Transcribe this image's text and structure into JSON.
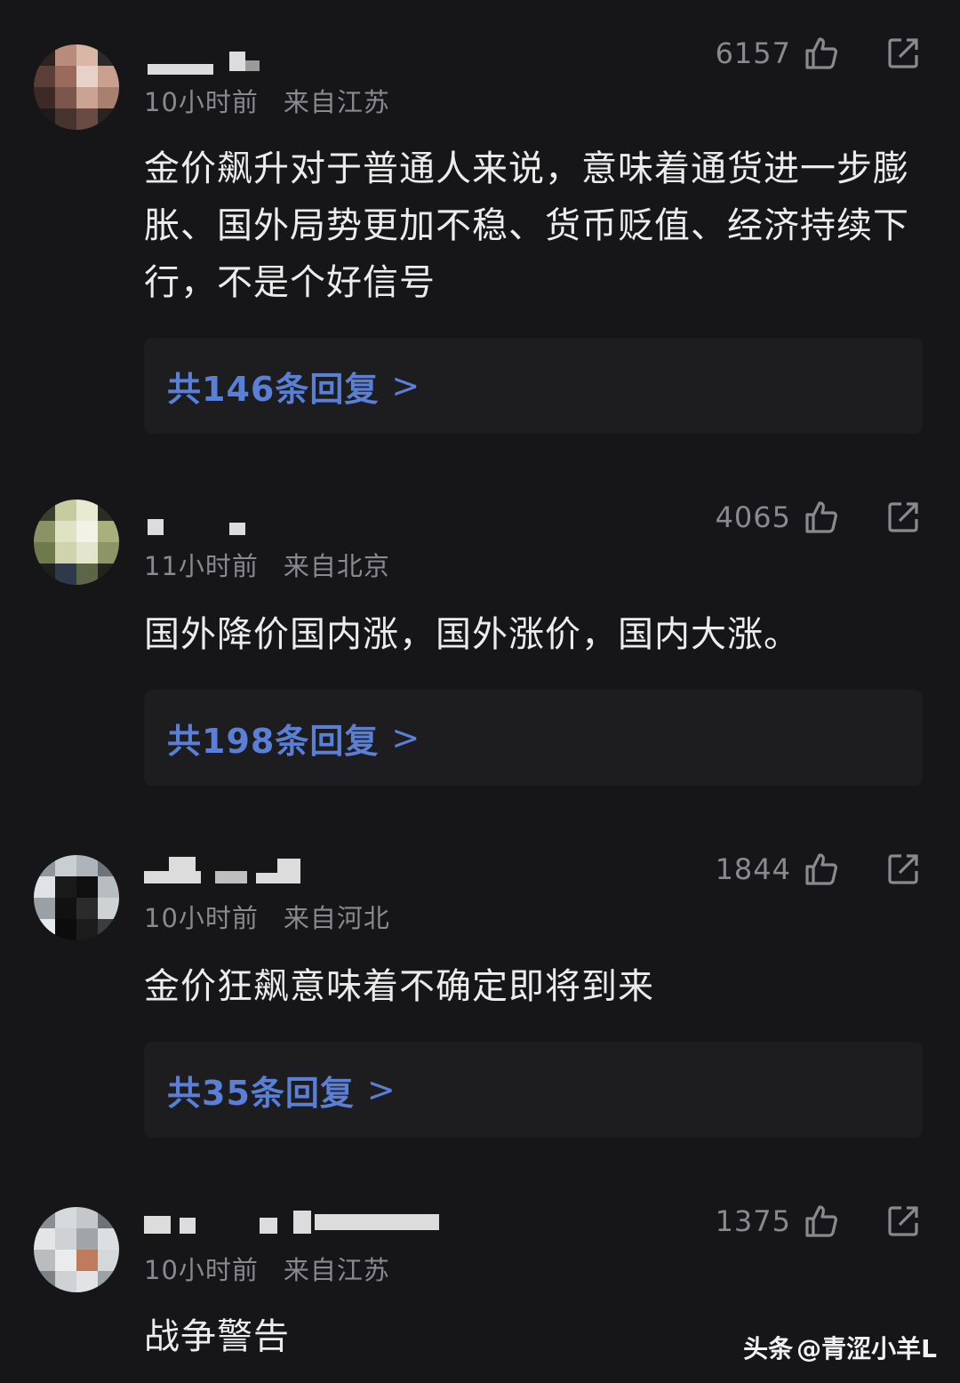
{
  "comments": [
    {
      "time": "10小时前",
      "location": "来自江苏",
      "likes": "6157",
      "text": "金价飙升对于普通人来说，意味着通货进一步膨胀、国外局势更加不稳、货币贬值、经济持续下行，不是个好信号",
      "replies": "共146条回复",
      "avatar_colors": [
        "#2a2320",
        "#b88c7a",
        "#d9b6a6",
        "#2b2b2b",
        "#5a3f38",
        "#9a6a5c",
        "#e6d2c8",
        "#c9a08f",
        "#3b2a27",
        "#7a564c",
        "#caa394",
        "#a98070",
        "#1e1a19",
        "#46342f",
        "#6a4b43",
        "#2a2320"
      ]
    },
    {
      "time": "11小时前",
      "location": "来自北京",
      "likes": "4065",
      "text": "国外降价国内涨，国外涨价，国内大涨。",
      "replies": "共198条回复",
      "avatar_colors": [
        "#3a3f2d",
        "#c6cba0",
        "#e8ebd1",
        "#2b2d25",
        "#8a9266",
        "#dfe2c3",
        "#f2f3e4",
        "#a9b07e",
        "#6f7a4c",
        "#cfd4ad",
        "#e3e6cc",
        "#8d9568",
        "#1e2019",
        "#2e3a4c",
        "#5c6646",
        "#22251c"
      ]
    },
    {
      "time": "10小时前",
      "location": "来自河北",
      "likes": "1844",
      "text": "金价狂飙意味着不确定即将到来",
      "replies": "共35条回复",
      "avatar_colors": [
        "#8f969c",
        "#c9ced2",
        "#aeb5ba",
        "#6d7378",
        "#dfe3e6",
        "#1a1a1a",
        "#0f0f0f",
        "#b7bdc1",
        "#9aa1a6",
        "#111111",
        "#2b2b2b",
        "#cdd2d5",
        "#e7eaec",
        "#0c0c0c",
        "#1c1c1c",
        "#3a3d40"
      ]
    },
    {
      "time": "10小时前",
      "location": "来自江苏",
      "likes": "1375",
      "text": "战争警告",
      "avatar_colors": [
        "#8a8f93",
        "#d7dadc",
        "#c4c8cb",
        "#6e7377",
        "#e3e5e7",
        "#cfd2d4",
        "#a0a5a8",
        "#dcdfe1",
        "#b9bdc0",
        "#e9ebec",
        "#c07a5c",
        "#d5d8da",
        "#7d8286",
        "#cfd2d4",
        "#e1e3e5",
        "#9da2a5"
      ]
    }
  ],
  "watermark": {
    "brand": "头条",
    "handle": "@青涩小羊L"
  },
  "icons": {
    "like": "thumbs-up-icon",
    "share": "share-icon"
  }
}
